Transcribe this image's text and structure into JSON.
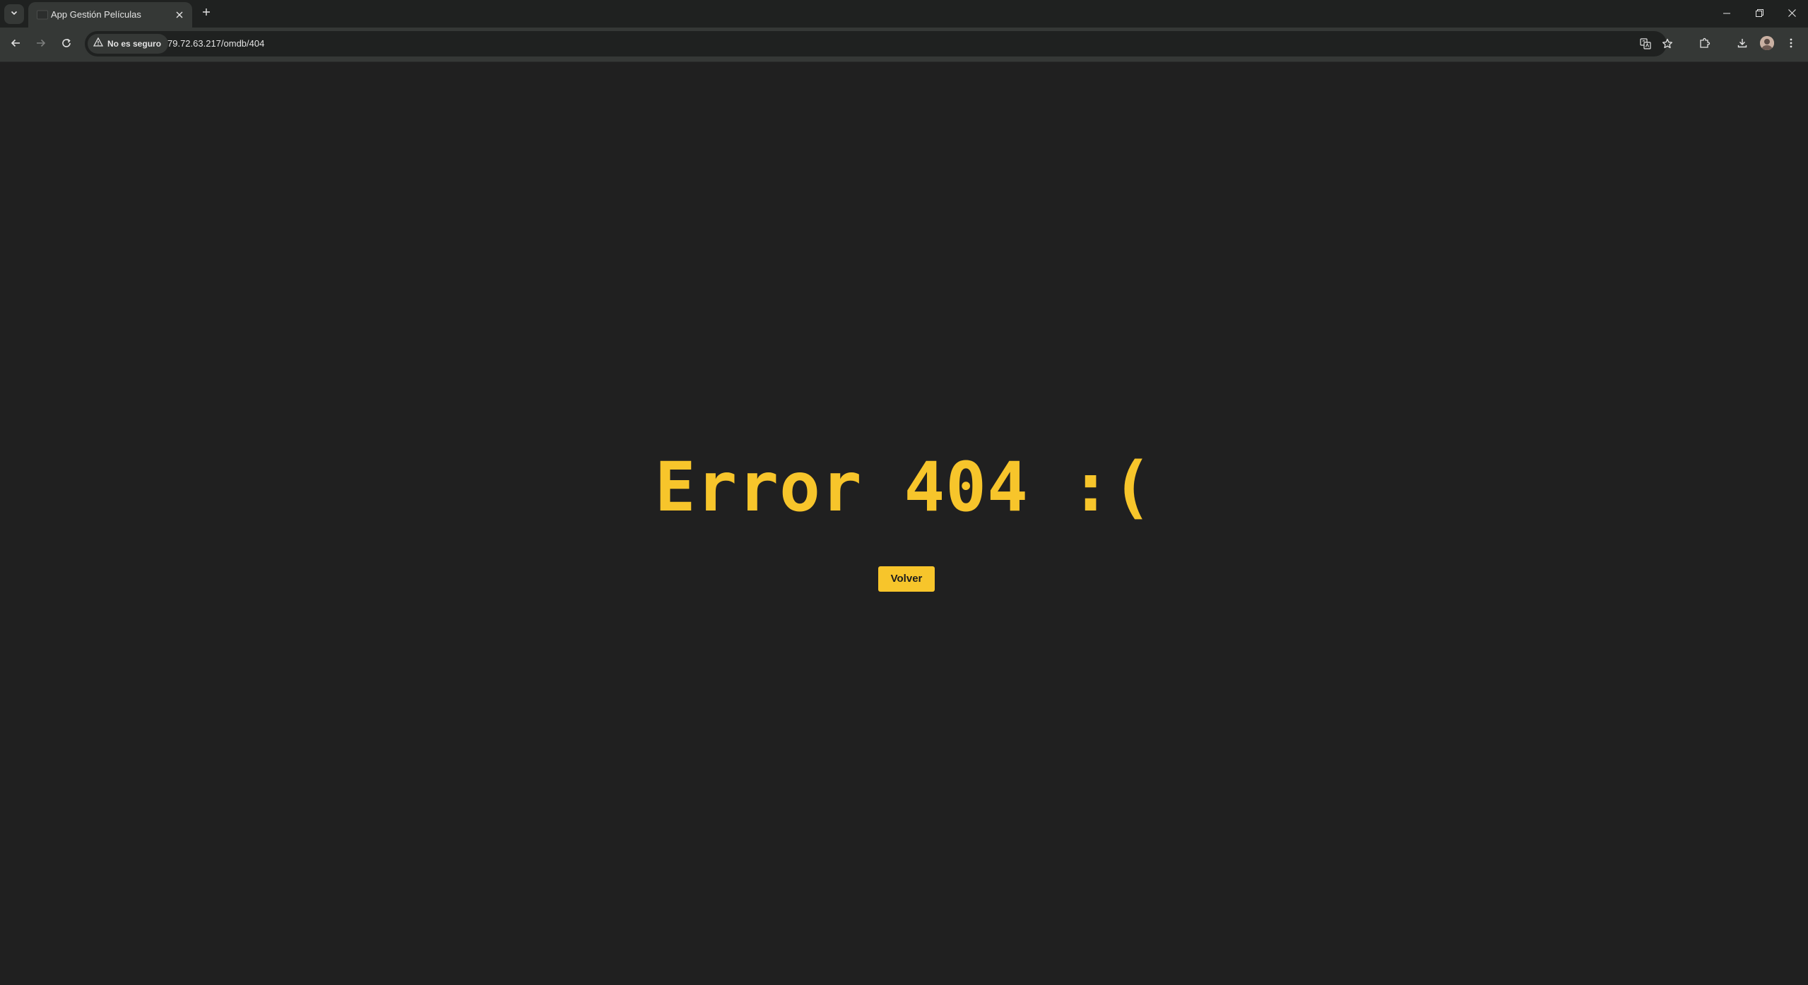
{
  "browser": {
    "tab": {
      "title": "App Gestión Películas",
      "favicon": "film-favicon-icon"
    },
    "address_bar": {
      "security_label": "No es seguro",
      "url": "79.72.63.217/omdb/404"
    },
    "icons": {
      "tab_search": "chevron-down-icon",
      "tab_close": "close-icon",
      "new_tab": "plus-icon",
      "minimize": "minimize-icon",
      "restore": "restore-icon",
      "close_window": "close-icon",
      "back": "arrow-left-icon",
      "forward": "arrow-right-icon",
      "reload": "reload-icon",
      "not_secure": "warning-triangle-icon",
      "translate": "translate-icon",
      "bookmark": "star-icon",
      "extensions": "puzzle-icon",
      "downloads": "download-icon",
      "profile": "avatar-icon",
      "menu": "kebab-menu-icon"
    }
  },
  "page": {
    "error_title": "Error 404 :(",
    "back_button_label": "Volver"
  },
  "colors": {
    "page_background": "#202020",
    "accent": "#f7c52b",
    "button_text": "#1c1c1c"
  }
}
